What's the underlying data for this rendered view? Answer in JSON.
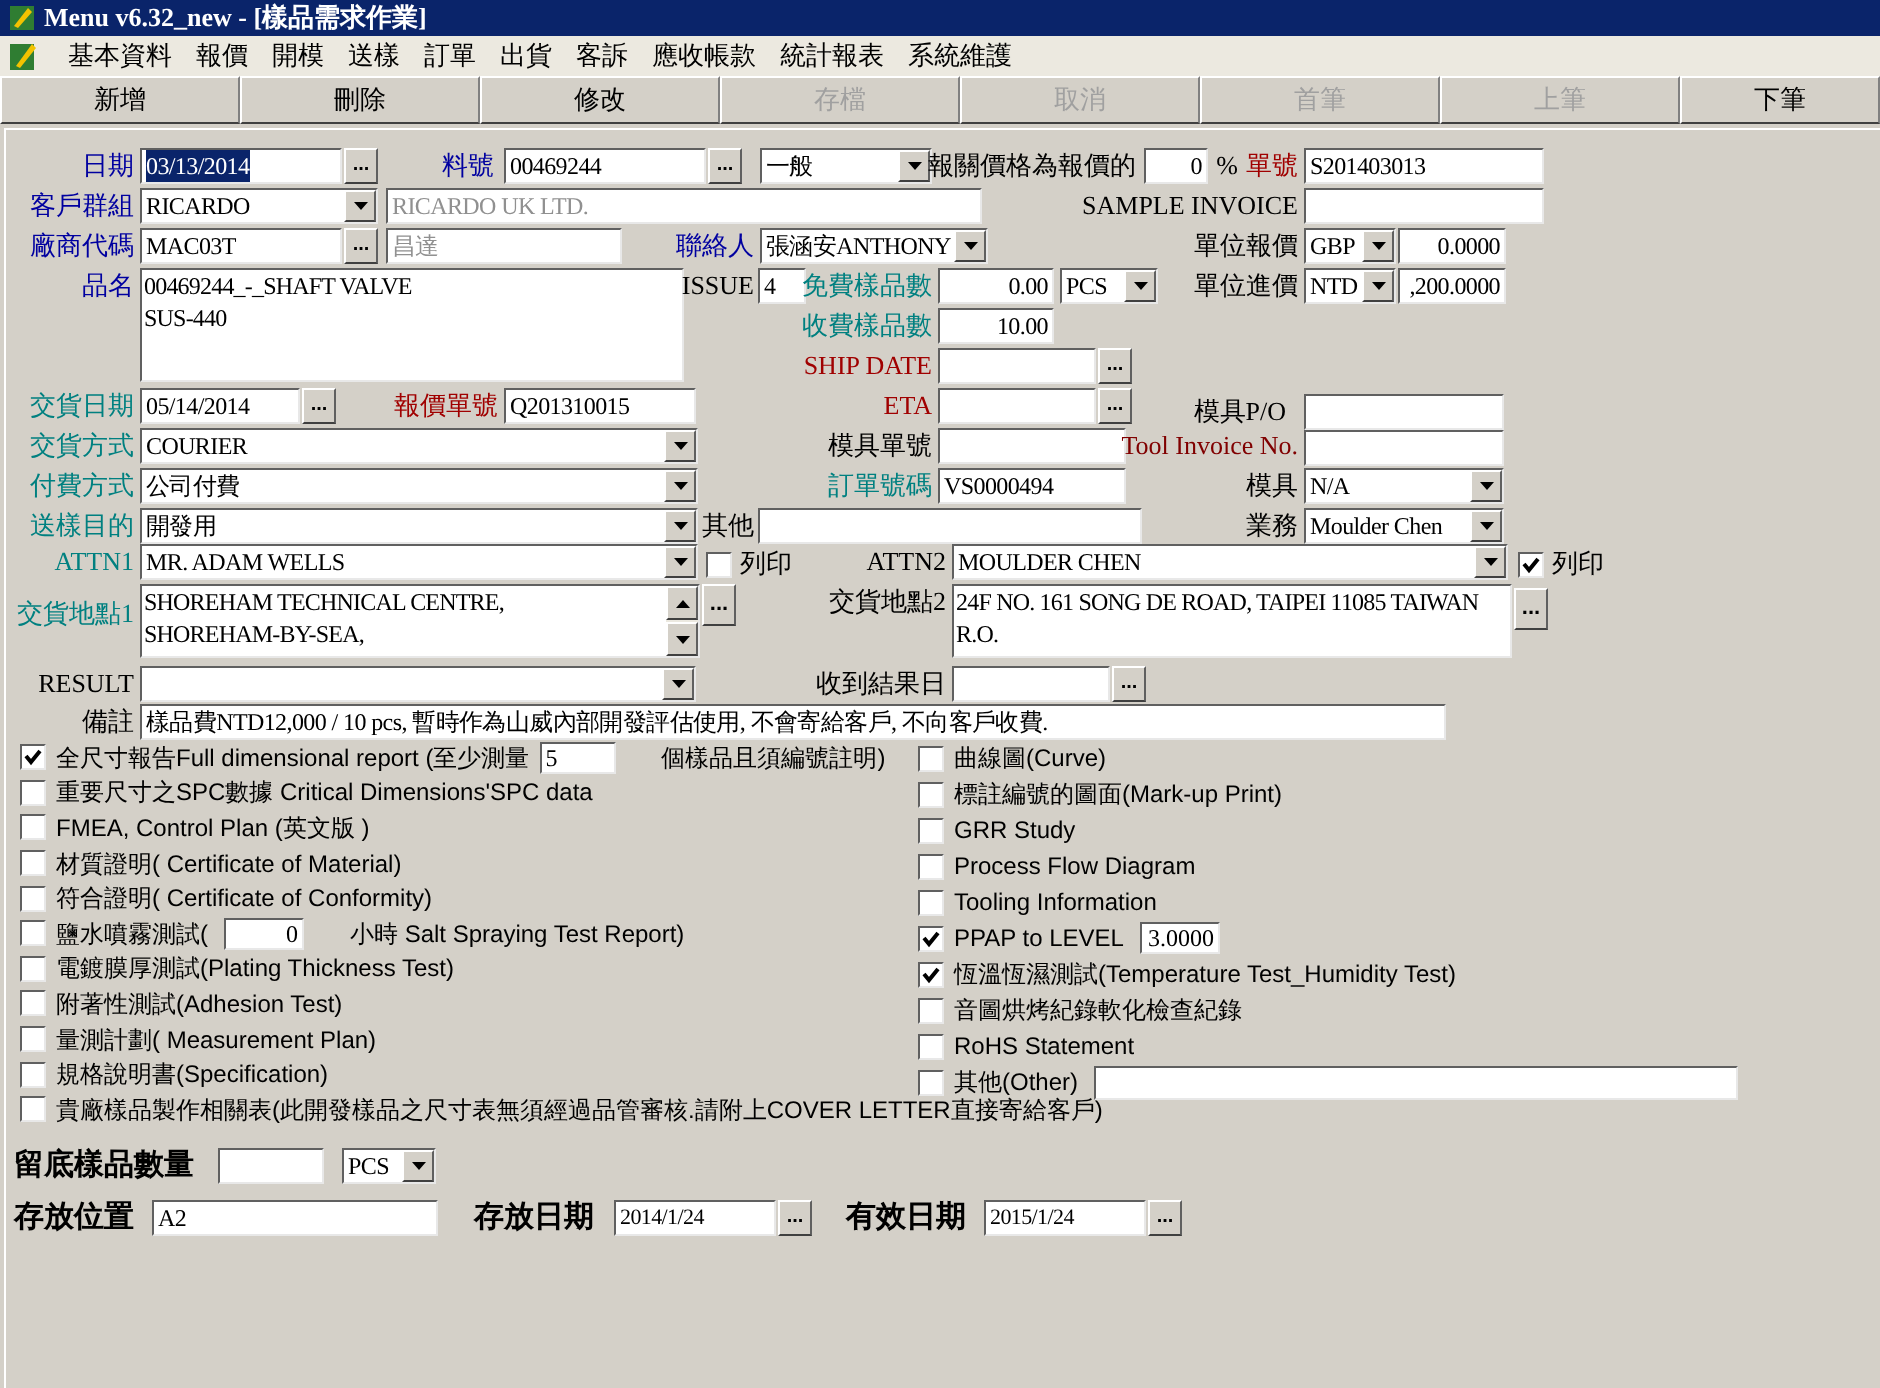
{
  "window": {
    "title": "Menu v6.32_new - [樣品需求作業]"
  },
  "menu": [
    "基本資料",
    "報價",
    "開模",
    "送樣",
    "訂單",
    "出貨",
    "客訴",
    "應收帳款",
    "統計報表",
    "系統維護"
  ],
  "toolbar": [
    {
      "label": "新增",
      "disabled": false
    },
    {
      "label": "刪除",
      "disabled": false
    },
    {
      "label": "修改",
      "disabled": false
    },
    {
      "label": "存檔",
      "disabled": true
    },
    {
      "label": "取消",
      "disabled": true
    },
    {
      "label": "首筆",
      "disabled": true
    },
    {
      "label": "上筆",
      "disabled": true
    },
    {
      "label": "下筆",
      "disabled": false
    }
  ],
  "fields": [
    {
      "kind": "label",
      "text": "日期",
      "color": "#0000a0"
    },
    {
      "kind": "picker",
      "value": "03/13/2014",
      "button": "...",
      "highlighted": true
    },
    {
      "kind": "label",
      "text": "料號",
      "color": "#0000a0"
    },
    {
      "kind": "picker",
      "value": "00469244",
      "button": "..."
    },
    {
      "kind": "combo",
      "value": "一般"
    },
    {
      "kind": "label",
      "text": "報關價格為報價的",
      "color": "#000000"
    },
    {
      "kind": "number",
      "value": "0"
    },
    {
      "kind": "label",
      "text": "%",
      "color": "#000000"
    },
    {
      "kind": "label",
      "text": "單號",
      "color": "#a00000"
    },
    {
      "kind": "text",
      "value": "S201403013"
    },
    {
      "kind": "label",
      "text": "客戶群組",
      "color": "#0000a0"
    },
    {
      "kind": "combo",
      "value": "RICARDO"
    },
    {
      "kind": "text",
      "value": "RICARDO UK LTD.",
      "disabled": true
    },
    {
      "kind": "label",
      "text": "SAMPLE INVOICE",
      "color": "#000000"
    },
    {
      "kind": "text"
    },
    {
      "kind": "label",
      "text": "廠商代碼",
      "color": "#0000a0"
    },
    {
      "kind": "picker",
      "value": "MAC03T",
      "button": "..."
    },
    {
      "kind": "text",
      "value": "昌達",
      "disabled": true
    },
    {
      "kind": "label",
      "text": "聯絡人",
      "color": "#0000a0"
    },
    {
      "kind": "combo",
      "value": "張涵安ANTHONY"
    },
    {
      "kind": "label",
      "text": "單位報價",
      "color": "#000000"
    },
    {
      "kind": "combo",
      "value": "GBP"
    },
    {
      "kind": "number",
      "value": "0.0000"
    },
    {
      "kind": "label",
      "text": "品名",
      "color": "#0000a0"
    },
    {
      "kind": "memo",
      "lines": [
        "00469244_-_SHAFT VALVE",
        "SUS-440"
      ]
    },
    {
      "kind": "label",
      "text": "ISSUE",
      "color": "#000000"
    },
    {
      "kind": "text",
      "value": "4"
    },
    {
      "kind": "label",
      "text": "免費樣品數",
      "color": "#008080"
    },
    {
      "kind": "number",
      "value": "0.00"
    },
    {
      "kind": "combo",
      "value": "PCS"
    },
    {
      "kind": "label",
      "text": "單位進價",
      "color": "#000000"
    },
    {
      "kind": "combo",
      "value": "NTD"
    },
    {
      "kind": "number",
      "value": ",200.0000"
    },
    {
      "kind": "label",
      "text": "收費樣品數",
      "color": "#008080"
    },
    {
      "kind": "number",
      "value": "10.00"
    },
    {
      "kind": "label",
      "text": "SHIP DATE",
      "color": "#a00000"
    },
    {
      "kind": "picker",
      "button": "..."
    },
    {
      "kind": "label",
      "text": "交貨日期",
      "color": "#008080"
    },
    {
      "kind": "picker",
      "value": "05/14/2014",
      "button": "..."
    },
    {
      "kind": "label",
      "text": "報價單號",
      "color": "#a00000"
    },
    {
      "kind": "text",
      "value": "Q201310015"
    },
    {
      "kind": "label",
      "text": "ETA",
      "color": "#a00000"
    },
    {
      "kind": "picker",
      "button": "..."
    },
    {
      "kind": "label",
      "text": "模具P/O",
      "color": "#000000"
    },
    {
      "kind": "text"
    },
    {
      "kind": "label",
      "text": "交貨方式",
      "color": "#008080"
    },
    {
      "kind": "combo",
      "value": "COURIER"
    },
    {
      "kind": "label",
      "text": "模具單號",
      "color": "#000000"
    },
    {
      "kind": "text"
    },
    {
      "kind": "label",
      "text": "Tool Invoice No.",
      "color": "#800000"
    },
    {
      "kind": "text"
    },
    {
      "kind": "label",
      "text": "付費方式",
      "color": "#008080"
    },
    {
      "kind": "combo",
      "value": "公司付費"
    },
    {
      "kind": "label",
      "text": "訂單號碼",
      "color": "#008080"
    },
    {
      "kind": "text",
      "value": "VS0000494"
    },
    {
      "kind": "label",
      "text": "模具",
      "color": "#000000"
    },
    {
      "kind": "combo",
      "value": "N/A"
    },
    {
      "kind": "label",
      "text": "送樣目的",
      "color": "#008080"
    },
    {
      "kind": "combo",
      "value": "開發用"
    },
    {
      "kind": "label",
      "text": "其他",
      "color": "#000000"
    },
    {
      "kind": "text"
    },
    {
      "kind": "label",
      "text": "業務",
      "color": "#000000"
    },
    {
      "kind": "combo",
      "value": "Moulder Chen"
    },
    {
      "kind": "label",
      "text": "ATTN1",
      "color": "#008080"
    },
    {
      "kind": "combo",
      "value": "MR. ADAM WELLS"
    },
    {
      "kind": "check",
      "label": "列印",
      "checked": false
    },
    {
      "kind": "label",
      "text": "ATTN2",
      "color": "#000000"
    },
    {
      "kind": "combo",
      "value": "MOULDER CHEN"
    },
    {
      "kind": "check",
      "label": "列印",
      "checked": true
    },
    {
      "kind": "label",
      "text": "交貨地點1",
      "color": "#008080"
    },
    {
      "kind": "memo",
      "lines": [
        "SHOREHAM TECHNICAL CENTRE,",
        "SHOREHAM-BY-SEA,"
      ],
      "scrollbar": true
    },
    {
      "kind": "button",
      "text": "..."
    },
    {
      "kind": "label",
      "text": "交貨地點2",
      "color": "#000000"
    },
    {
      "kind": "memo",
      "lines": [
        "24F NO. 161 SONG DE ROAD, TAIPEI 11085 TAIWAN",
        "R.O."
      ]
    },
    {
      "kind": "button",
      "text": "..."
    },
    {
      "kind": "label",
      "text": "RESULT",
      "color": "#000000"
    },
    {
      "kind": "combo"
    },
    {
      "kind": "label",
      "text": "收到結果日",
      "color": "#000000"
    },
    {
      "kind": "picker",
      "button": "..."
    },
    {
      "kind": "label",
      "text": "備註",
      "color": "#000000"
    },
    {
      "kind": "text",
      "value": "樣品費NTD12,000 / 10 pcs, 暫時作為山威內部開發評估使用, 不會寄給客戶, 不向客戶收費."
    },
    {
      "kind": "caption",
      "text": "留底樣品數量"
    },
    {
      "kind": "text"
    },
    {
      "kind": "combo",
      "value": "PCS"
    },
    {
      "kind": "caption",
      "text": "存放位置"
    },
    {
      "kind": "text",
      "value": "A2"
    },
    {
      "kind": "caption",
      "text": "存放日期"
    },
    {
      "kind": "picker",
      "value": "2014/1/24",
      "button": "...",
      "small": true
    },
    {
      "kind": "caption",
      "text": "有效日期"
    },
    {
      "kind": "picker",
      "value": "2015/1/24",
      "button": "...",
      "small": true
    }
  ],
  "checklist_left": [
    {
      "kind": "input",
      "label": "全尺寸報告Full dimensional report (至少測量",
      "value": "5",
      "suffix": "個樣品且須編號註明)",
      "checked": true
    },
    {
      "kind": "plain",
      "label": "重要尺寸之SPC數據 Critical Dimensions'SPC data",
      "checked": false
    },
    {
      "kind": "plain",
      "label": "FMEA, Control Plan (英文版 )",
      "checked": false
    },
    {
      "kind": "plain",
      "label": "材質證明( Certificate of Material)",
      "checked": false
    },
    {
      "kind": "plain",
      "label": "符合證明( Certificate of Conformity)",
      "checked": false
    },
    {
      "kind": "number",
      "label": "鹽水噴霧測試(",
      "value": "0",
      "suffix": "小時 Salt Spraying Test Report)",
      "checked": false
    },
    {
      "kind": "plain",
      "label": "電鍍膜厚測試(Plating Thickness Test)",
      "checked": false
    },
    {
      "kind": "plain",
      "label": "附著性測試(Adhesion Test)",
      "checked": false
    },
    {
      "kind": "plain",
      "label": "量測計劃( Measurement Plan)",
      "checked": false
    },
    {
      "kind": "plain",
      "label": "規格說明書(Specification)",
      "checked": false
    },
    {
      "kind": "plain",
      "label": "貴廠樣品製作相關表(此開發樣品之尺寸表無須經過品管審核.請附上COVER LETTER直接寄給客戶)",
      "checked": false
    }
  ],
  "checklist_right": [
    {
      "kind": "plain",
      "label": "曲線圖(Curve)",
      "checked": false
    },
    {
      "kind": "plain",
      "label": "標註編號的圖面(Mark-up Print)",
      "checked": false
    },
    {
      "kind": "plain",
      "label": "GRR Study",
      "checked": false
    },
    {
      "kind": "plain",
      "label": "Process Flow Diagram",
      "checked": false
    },
    {
      "kind": "plain",
      "label": "Tooling Information",
      "checked": false
    },
    {
      "kind": "number",
      "label": "PPAP  to LEVEL",
      "value": "3.0000",
      "checked": true
    },
    {
      "kind": "plain",
      "label": "恆溫恆濕測試(Temperature Test_Humidity Test)",
      "checked": true
    },
    {
      "kind": "plain",
      "label": "音圖烘烤紀錄軟化檢查紀錄",
      "checked": false
    },
    {
      "kind": "plain",
      "label": "RoHS Statement",
      "checked": false
    },
    {
      "kind": "field",
      "label": "其他(Other)",
      "checked": false
    }
  ]
}
